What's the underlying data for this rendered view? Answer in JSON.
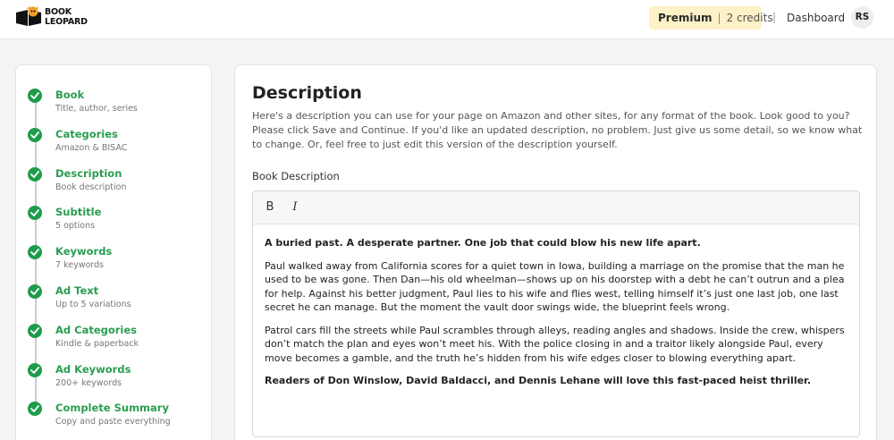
{
  "header": {
    "logo_line1": "BOOK",
    "logo_line2": "LEOPARD",
    "plan_label": "Premium",
    "separator": "|",
    "credits": "2 credits",
    "nav_separator": "|",
    "dashboard_label": "Dashboard",
    "avatar_initials": "RS",
    "accent_color": "#fdf1c7"
  },
  "sidebar": {
    "steps": [
      {
        "title": "Book",
        "subtitle": "Title, author, series",
        "status": "complete"
      },
      {
        "title": "Categories",
        "subtitle": "Amazon & BISAC",
        "status": "complete"
      },
      {
        "title": "Description",
        "subtitle": "Book description",
        "status": "complete"
      },
      {
        "title": "Subtitle",
        "subtitle": "5 options",
        "status": "complete"
      },
      {
        "title": "Keywords",
        "subtitle": "7 keywords",
        "status": "complete"
      },
      {
        "title": "Ad Text",
        "subtitle": "Up to 5 variations",
        "status": "complete"
      },
      {
        "title": "Ad Categories",
        "subtitle": "Kindle & paperback",
        "status": "complete"
      },
      {
        "title": "Ad Keywords",
        "subtitle": "200+ keywords",
        "status": "complete"
      },
      {
        "title": "Complete Summary",
        "subtitle": "Copy and paste everything",
        "status": "complete"
      }
    ],
    "complete_color": "#1e9c4a"
  },
  "main": {
    "title": "Description",
    "intro": "Here's a description you can use for your page on Amazon and other sites, for any format of the book. Look good to you? Please click Save and Continue. If you'd like an updated description, no problem. Just give us some detail, so we know what to change. Or, feel free to just edit this version of the description yourself.",
    "field_label": "Book Description",
    "toolbar": {
      "bold_label": "B",
      "italic_label": "I"
    },
    "paragraphs": [
      {
        "text": "A buried past. A desperate partner. One job that could blow his new life apart.",
        "bold": true
      },
      {
        "text": "Paul walked away from California scores for a quiet town in Iowa, building a marriage on the promise that the man he used to be was gone. Then Dan—his old wheelman—shows up on his doorstep with a debt he can’t outrun and a plea for help. Against his better judgment, Paul lies to his wife and flies west, telling himself it’s just one last job, one last secret he can manage. But the moment the vault door swings wide, the blueprint feels wrong.",
        "bold": false
      },
      {
        "text": "Patrol cars fill the streets while Paul scrambles through alleys, reading angles and shadows. Inside the crew, whispers don’t match the plan and eyes won’t meet his. With the police closing in and a traitor likely alongside Paul, every move becomes a gamble, and the truth he’s hidden from his wife edges closer to blowing everything apart.",
        "bold": false
      },
      {
        "text": "Readers of Don Winslow, David Baldacci, and Dennis Lehane will love this fast-paced heist thriller.",
        "bold": true
      }
    ]
  }
}
